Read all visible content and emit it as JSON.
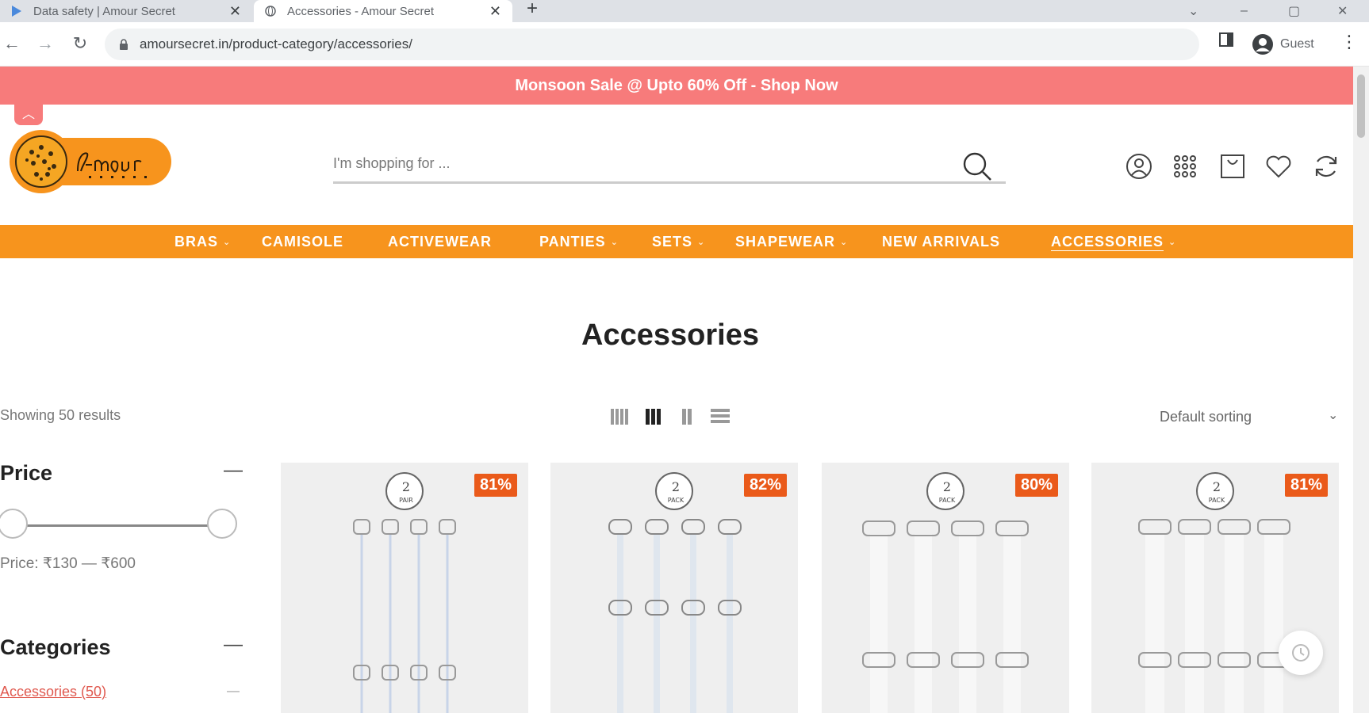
{
  "browser": {
    "tabs": [
      {
        "title": "Data safety | Amour Secret",
        "active": false
      },
      {
        "title": "Accessories - Amour Secret",
        "active": true
      }
    ],
    "url": "amoursecret.in/product-category/accessories/",
    "profile_label": "Guest"
  },
  "promo_banner": "Monsoon Sale @ Upto 60% Off - Shop Now",
  "search": {
    "placeholder": "I'm shopping for ..."
  },
  "header_icons": [
    "account-icon",
    "grid-menu-icon",
    "cart-icon",
    "wishlist-heart-icon",
    "compare-icon"
  ],
  "nav": {
    "items": [
      {
        "label": "BRAS",
        "dropdown": true
      },
      {
        "label": "CAMISOLE",
        "dropdown": false
      },
      {
        "label": "ACTIVEWEAR",
        "dropdown": false
      },
      {
        "label": "PANTIES",
        "dropdown": true
      },
      {
        "label": "SETS",
        "dropdown": true
      },
      {
        "label": "SHAPEWEAR",
        "dropdown": true
      },
      {
        "label": "NEW ARRIVALS",
        "dropdown": false
      },
      {
        "label": "ACCESSORIES",
        "dropdown": true,
        "active": true
      }
    ],
    "caret": "⌄"
  },
  "page_title": "Accessories",
  "results_text": "Showing 50 results",
  "sort": {
    "selected": "Default sorting"
  },
  "filters": {
    "price": {
      "title": "Price",
      "toggle": "—",
      "label": "Price: ₹130 — ₹600",
      "min_fraction": 0.0,
      "max_fraction": 1.0
    },
    "categories": {
      "title": "Categories",
      "toggle": "—",
      "items": [
        {
          "name": "Accessories",
          "count": "(50)"
        }
      ]
    }
  },
  "products": [
    {
      "discount": "81%",
      "pack_top": "2",
      "pack_bottom": "PAIR"
    },
    {
      "discount": "82%",
      "pack_top": "2",
      "pack_bottom": "PACK"
    },
    {
      "discount": "80%",
      "pack_top": "2",
      "pack_bottom": "PACK"
    },
    {
      "discount": "81%",
      "pack_top": "2",
      "pack_bottom": "PACK"
    }
  ],
  "colors": {
    "promo": "#f77b7b",
    "nav": "#f7941d",
    "badge": "#ea5a1a",
    "link": "#e0594f"
  }
}
